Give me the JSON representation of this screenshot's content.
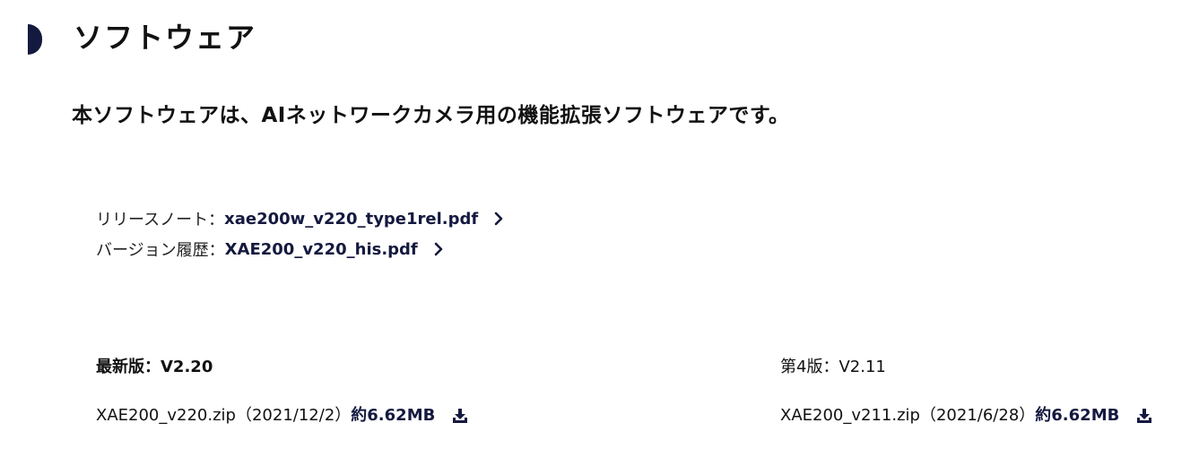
{
  "section": {
    "title": "ソフトウェア",
    "description": "本ソフトウェアは、AIネットワークカメラ用の機能拡張ソフトウェアです。"
  },
  "documents": [
    {
      "label": "リリースノート：",
      "file": "xae200w_v220_type1rel.pdf",
      "icon": "chevron-right-icon"
    },
    {
      "label": "バージョン履歴：",
      "file": "XAE200_v220_his.pdf",
      "icon": "chevron-right-icon"
    }
  ],
  "versions": {
    "latest": {
      "label": "最新版：V2.20",
      "file_text": "XAE200_v220.zip（2021/12/2）",
      "size": "約6.62MB",
      "icon": "download-icon"
    },
    "previous": {
      "label": "第4版：V2.11",
      "file_text": "XAE200_v211.zip（2021/6/28）",
      "size": "約6.62MB",
      "icon": "download-icon"
    }
  },
  "colors": {
    "accent": "#14193f",
    "text": "#111111"
  }
}
